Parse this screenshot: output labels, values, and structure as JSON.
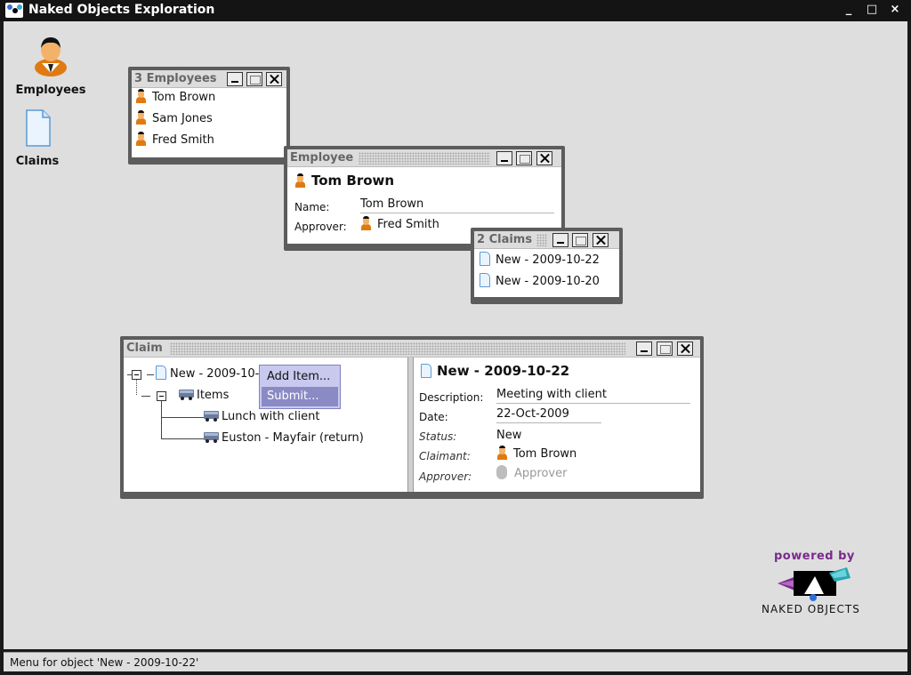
{
  "window": {
    "title": "Naked Objects Exploration",
    "controls": {
      "minimize": "_",
      "maximize": "□",
      "close": "×"
    }
  },
  "desktop_icons": [
    {
      "label": "Employees",
      "icon": "person-icon"
    },
    {
      "label": "Claims",
      "icon": "document-icon"
    }
  ],
  "employees_window": {
    "title": "3 Employees",
    "items": [
      "Tom Brown",
      "Sam Jones",
      "Fred Smith"
    ]
  },
  "employee_window": {
    "title": "Employee",
    "heading": "Tom Brown",
    "name_label": "Name:",
    "name_value": "Tom Brown",
    "approver_label": "Approver:",
    "approver_value": "Fred Smith"
  },
  "claims_window": {
    "title": "2 Claims",
    "items": [
      "New - 2009-10-22",
      "New - 2009-10-20"
    ]
  },
  "claim_window": {
    "title": "Claim",
    "tree": {
      "root": "New - 2009-10-",
      "items_label": "Items",
      "children": [
        "Lunch with client",
        "Euston - Mayfair (return)"
      ]
    },
    "context_menu": [
      "Add Item...",
      "Submit..."
    ],
    "detail": {
      "heading": "New - 2009-10-22",
      "description_label": "Description:",
      "description_value": "Meeting with client",
      "date_label": "Date:",
      "date_value": "22-Oct-2009",
      "status_label": "Status:",
      "status_value": "New",
      "claimant_label": "Claimant:",
      "claimant_value": "Tom Brown",
      "approver_label": "Approver:",
      "approver_value": "Approver"
    }
  },
  "branding": {
    "powered_by": "powered by",
    "name": "NAKED OBJECTS"
  },
  "status_bar": "Menu for object 'New - 2009-10-22'",
  "colors": {
    "window_frame": "#5c5c5c",
    "desktop": "#dedede",
    "menu_bg": "#c9c9f0",
    "menu_selected": "#8a8ac4",
    "brand_purple": "#7a2a8c"
  }
}
